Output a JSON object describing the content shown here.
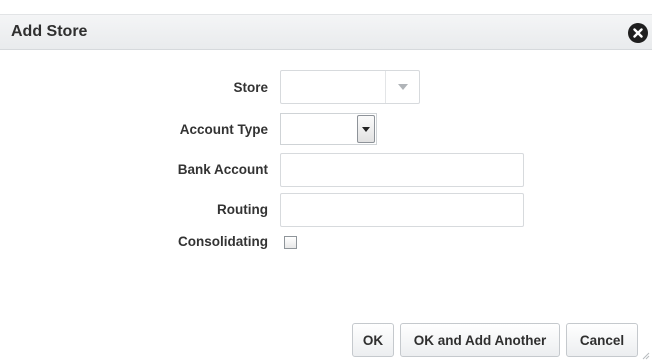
{
  "dialog": {
    "title": "Add Store",
    "close_icon": "close-circle-x-icon"
  },
  "form": {
    "store": {
      "label": "Store",
      "value": ""
    },
    "account_type": {
      "label": "Account Type",
      "value": ""
    },
    "bank_account": {
      "label": "Bank Account",
      "value": ""
    },
    "routing": {
      "label": "Routing",
      "value": ""
    },
    "consolidating": {
      "label": "Consolidating",
      "checked": false
    }
  },
  "footer": {
    "ok_label": "OK",
    "ok_add_label": "OK and Add Another",
    "cancel_label": "Cancel"
  }
}
